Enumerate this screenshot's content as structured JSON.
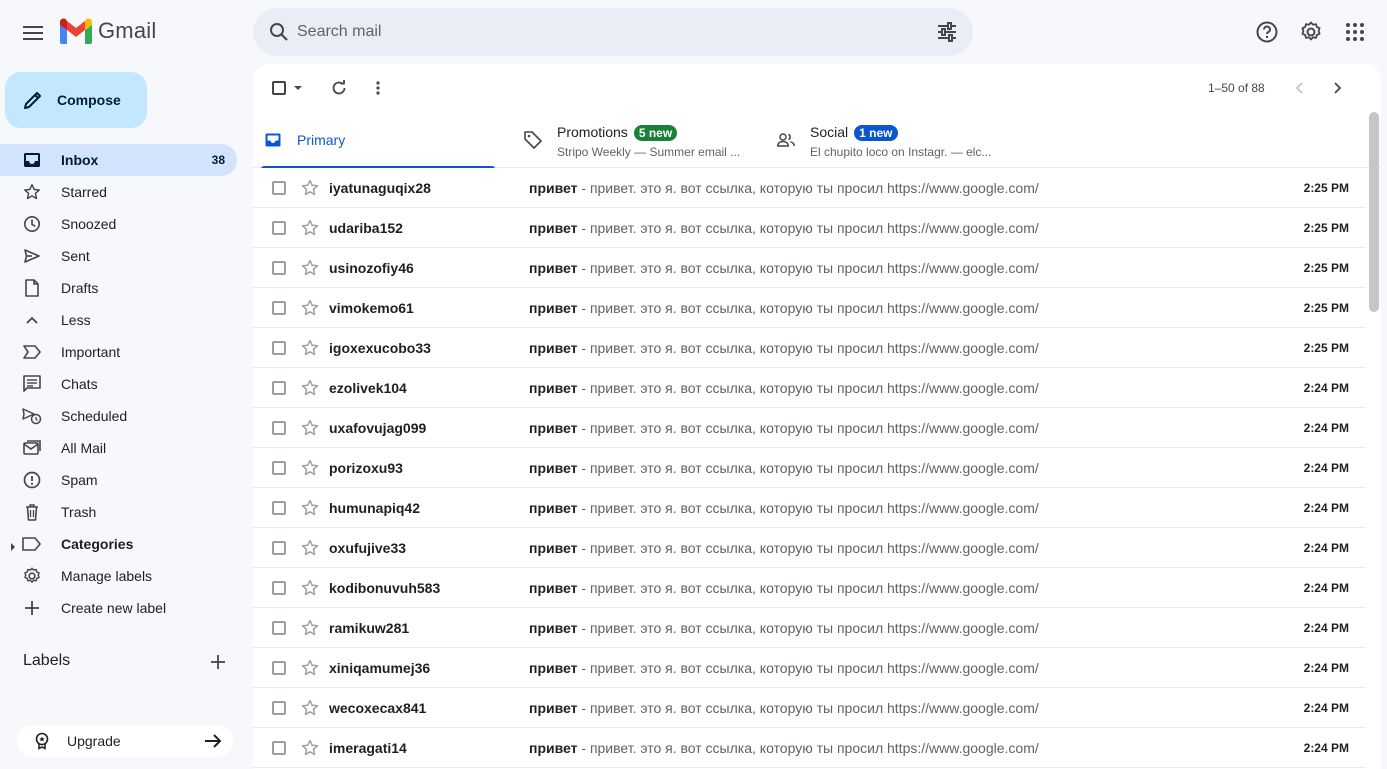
{
  "app": {
    "name": "Gmail"
  },
  "search": {
    "placeholder": "Search mail"
  },
  "compose": {
    "label": "Compose"
  },
  "sidebar": {
    "items": [
      {
        "label": "Inbox",
        "count": "38",
        "icon": "inbox-icon",
        "active": true
      },
      {
        "label": "Starred",
        "icon": "star-icon"
      },
      {
        "label": "Snoozed",
        "icon": "clock-icon"
      },
      {
        "label": "Sent",
        "icon": "send-icon"
      },
      {
        "label": "Drafts",
        "icon": "draft-icon"
      },
      {
        "label": "Less",
        "icon": "chevron-up-icon"
      },
      {
        "label": "Important",
        "icon": "important-icon"
      },
      {
        "label": "Chats",
        "icon": "chat-icon"
      },
      {
        "label": "Scheduled",
        "icon": "scheduled-icon"
      },
      {
        "label": "All Mail",
        "icon": "all-mail-icon"
      },
      {
        "label": "Spam",
        "icon": "spam-icon"
      },
      {
        "label": "Trash",
        "icon": "trash-icon"
      },
      {
        "label": "Categories",
        "icon": "label-icon",
        "bold": true
      },
      {
        "label": "Manage labels",
        "icon": "gear-icon"
      },
      {
        "label": "Create new label",
        "icon": "plus-icon"
      }
    ],
    "labels_heading": "Labels",
    "upgrade_label": "Upgrade"
  },
  "toolbar": {
    "pager": "1–50 of 88"
  },
  "tabs": [
    {
      "title": "Primary",
      "icon": "inbox-icon",
      "active": true
    },
    {
      "title": "Promotions",
      "badge": "5 new",
      "badge_color": "#188038",
      "subtitle": "Stripo Weekly — Summer email ...",
      "icon": "tag-icon"
    },
    {
      "title": "Social",
      "badge": "1 new",
      "badge_color": "#0b57d0",
      "subtitle": "El chupito loco on Instagr. — elc...",
      "icon": "people-icon"
    }
  ],
  "emails": [
    {
      "sender": "iyatunaguqix28",
      "subject": "привет",
      "snippet": " - привет. это я. вот ссылка, которую ты просил https://www.google.com/",
      "time": "2:25 PM"
    },
    {
      "sender": "udariba152",
      "subject": "привет",
      "snippet": " - привет. это я. вот ссылка, которую ты просил https://www.google.com/",
      "time": "2:25 PM"
    },
    {
      "sender": "usinozofiy46",
      "subject": "привет",
      "snippet": " - привет. это я. вот ссылка, которую ты просил https://www.google.com/",
      "time": "2:25 PM"
    },
    {
      "sender": "vimokemo61",
      "subject": "привет",
      "snippet": " - привет. это я. вот ссылка, которую ты просил https://www.google.com/",
      "time": "2:25 PM"
    },
    {
      "sender": "igoxexucobo33",
      "subject": "привет",
      "snippet": " - привет. это я. вот ссылка, которую ты просил https://www.google.com/",
      "time": "2:25 PM"
    },
    {
      "sender": "ezolivek104",
      "subject": "привет",
      "snippet": " - привет. это я. вот ссылка, которую ты просил https://www.google.com/",
      "time": "2:24 PM"
    },
    {
      "sender": "uxafovujag099",
      "subject": "привет",
      "snippet": " - привет. это я. вот ссылка, которую ты просил https://www.google.com/",
      "time": "2:24 PM"
    },
    {
      "sender": "porizoxu93",
      "subject": "привет",
      "snippet": " - привет. это я. вот ссылка, которую ты просил https://www.google.com/",
      "time": "2:24 PM"
    },
    {
      "sender": "humunapiq42",
      "subject": "привет",
      "snippet": " - привет. это я. вот ссылка, которую ты просил https://www.google.com/",
      "time": "2:24 PM"
    },
    {
      "sender": "oxufujive33",
      "subject": "привет",
      "snippet": " - привет. это я. вот ссылка, которую ты просил https://www.google.com/",
      "time": "2:24 PM"
    },
    {
      "sender": "kodibonuvuh583",
      "subject": "привет",
      "snippet": " - привет. это я. вот ссылка, которую ты просил https://www.google.com/",
      "time": "2:24 PM"
    },
    {
      "sender": "ramikuw281",
      "subject": "привет",
      "snippet": " - привет. это я. вот ссылка, которую ты просил https://www.google.com/",
      "time": "2:24 PM"
    },
    {
      "sender": "xiniqamumej36",
      "subject": "привет",
      "snippet": " - привет. это я. вот ссылка, которую ты просил https://www.google.com/",
      "time": "2:24 PM"
    },
    {
      "sender": "wecoxecax841",
      "subject": "привет",
      "snippet": " - привет. это я. вот ссылка, которую ты просил https://www.google.com/",
      "time": "2:24 PM"
    },
    {
      "sender": "imeragati14",
      "subject": "привет",
      "snippet": " - привет. это я. вот ссылка, которую ты просил https://www.google.com/",
      "time": "2:24 PM"
    }
  ]
}
